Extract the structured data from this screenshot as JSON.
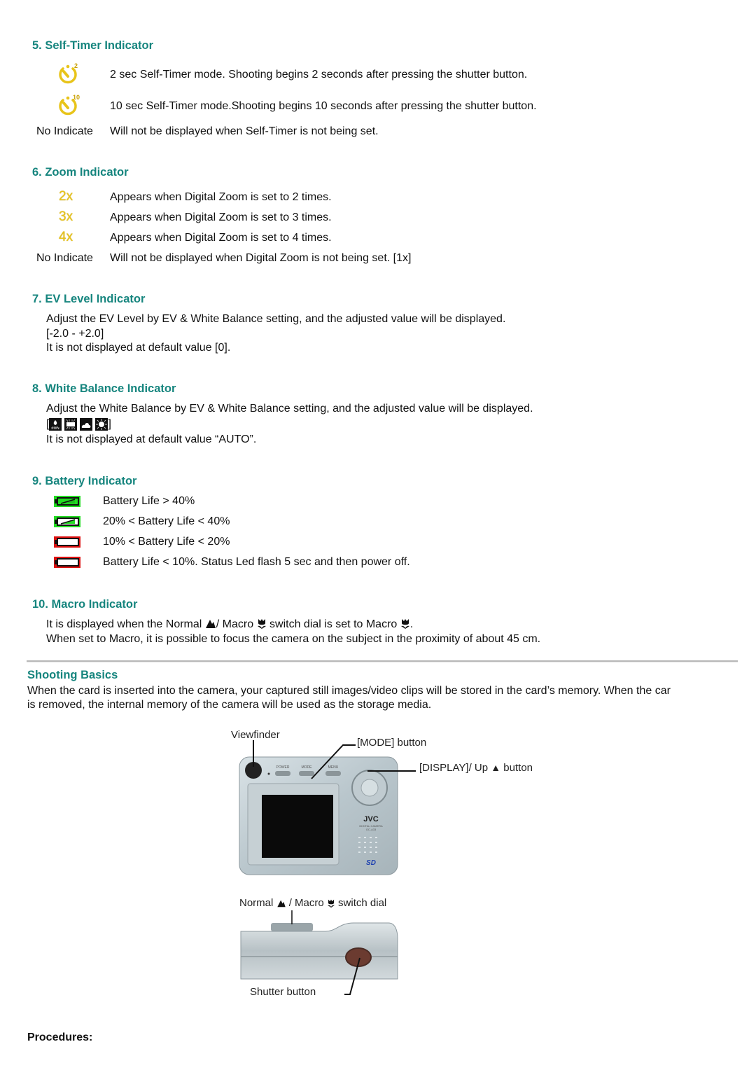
{
  "sections": {
    "self_timer": {
      "heading": "5. Self-Timer Indicator",
      "rows": [
        {
          "icon": "self-timer-2-icon",
          "icon_sup": "2",
          "text": "2 sec Self-Timer mode. Shooting begins 2 seconds after pressing the shutter button."
        },
        {
          "icon": "self-timer-10-icon",
          "icon_sup": "10",
          "text": "10 sec Self-Timer mode.Shooting begins 10 seconds after pressing the shutter button."
        },
        {
          "label": "No Indicate",
          "text": "Will not be displayed when Self-Timer is not being set."
        }
      ]
    },
    "zoom": {
      "heading": "6. Zoom Indicator",
      "rows": [
        {
          "icon_text": "2x",
          "text": "Appears when Digital Zoom is set to 2 times."
        },
        {
          "icon_text": "3x",
          "text": "Appears when Digital Zoom is set to 3 times."
        },
        {
          "icon_text": "4x",
          "text": "Appears when Digital Zoom is set to 4 times."
        },
        {
          "label": "No Indicate",
          "text": "Will not be displayed when Digital Zoom is not being set. [1x]"
        }
      ]
    },
    "ev": {
      "heading": "7. EV Level Indicator",
      "line1": "Adjust the EV Level by EV & White Balance setting, and the adjusted value will be displayed.",
      "line2": "[-2.0 - +2.0]",
      "line3": "It is not displayed at default value [0]."
    },
    "wb": {
      "heading": "8. White Balance Indicator",
      "line1": "Adjust the White Balance by EV & White Balance setting, and the adjusted value will be displayed.",
      "bracket_open": "[",
      "bracket_close": "]",
      "icons": [
        "wb-incandescent-icon",
        "wb-fluorescent-icon",
        "wb-cloudy-icon",
        "wb-daylight-icon"
      ],
      "line3": "It is not displayed at default value “AUTO”."
    },
    "battery": {
      "heading": "9. Battery Indicator",
      "rows": [
        {
          "level": "full",
          "color": "#22dd22",
          "text": "Battery Life > 40%"
        },
        {
          "level": "half",
          "color": "#22dd22",
          "text": "20% < Battery Life < 40%"
        },
        {
          "level": "low",
          "color": "#dd1111",
          "text": "10% < Battery Life < 20%"
        },
        {
          "level": "empty",
          "color": "#dd1111",
          "text": "Battery Life < 10%. Status Led flash 5 sec and then power off."
        }
      ]
    },
    "macro": {
      "heading": "10. Macro Indicator",
      "line1_a": "It is displayed when the Normal ",
      "line1_b": "/ Macro ",
      "line1_c": " switch dial is set to Macro ",
      "line1_d": ".",
      "line2": "When set to Macro, it is possible to focus the camera on the subject in the proximity of about 45 cm."
    }
  },
  "shooting_basics": {
    "heading": "Shooting Basics",
    "line1": "When the card is inserted into the camera, your captured still images/video clips will be stored in the card’s memory. When the car",
    "line2": "is removed, the internal memory of the camera will be used as the storage media.",
    "figure_front": {
      "labels": {
        "viewfinder": "Viewfinder",
        "mode_button": "[MODE] button",
        "display_button_a": "[DISPLAY]/ Up",
        "display_button_b": "button"
      },
      "camera_buttons": [
        "POWER",
        "MODE",
        "MENU"
      ],
      "brand": "JVC",
      "model_line1": "DIGITAL CAMERA",
      "model_line2": "GC-A33",
      "card_logo": "SD"
    },
    "figure_top": {
      "labels": {
        "switch_a": "Normal",
        "switch_b": "/ Macro",
        "switch_c": "switch dial",
        "shutter": "Shutter button"
      }
    }
  },
  "procedures": {
    "heading": "Procedures:"
  }
}
